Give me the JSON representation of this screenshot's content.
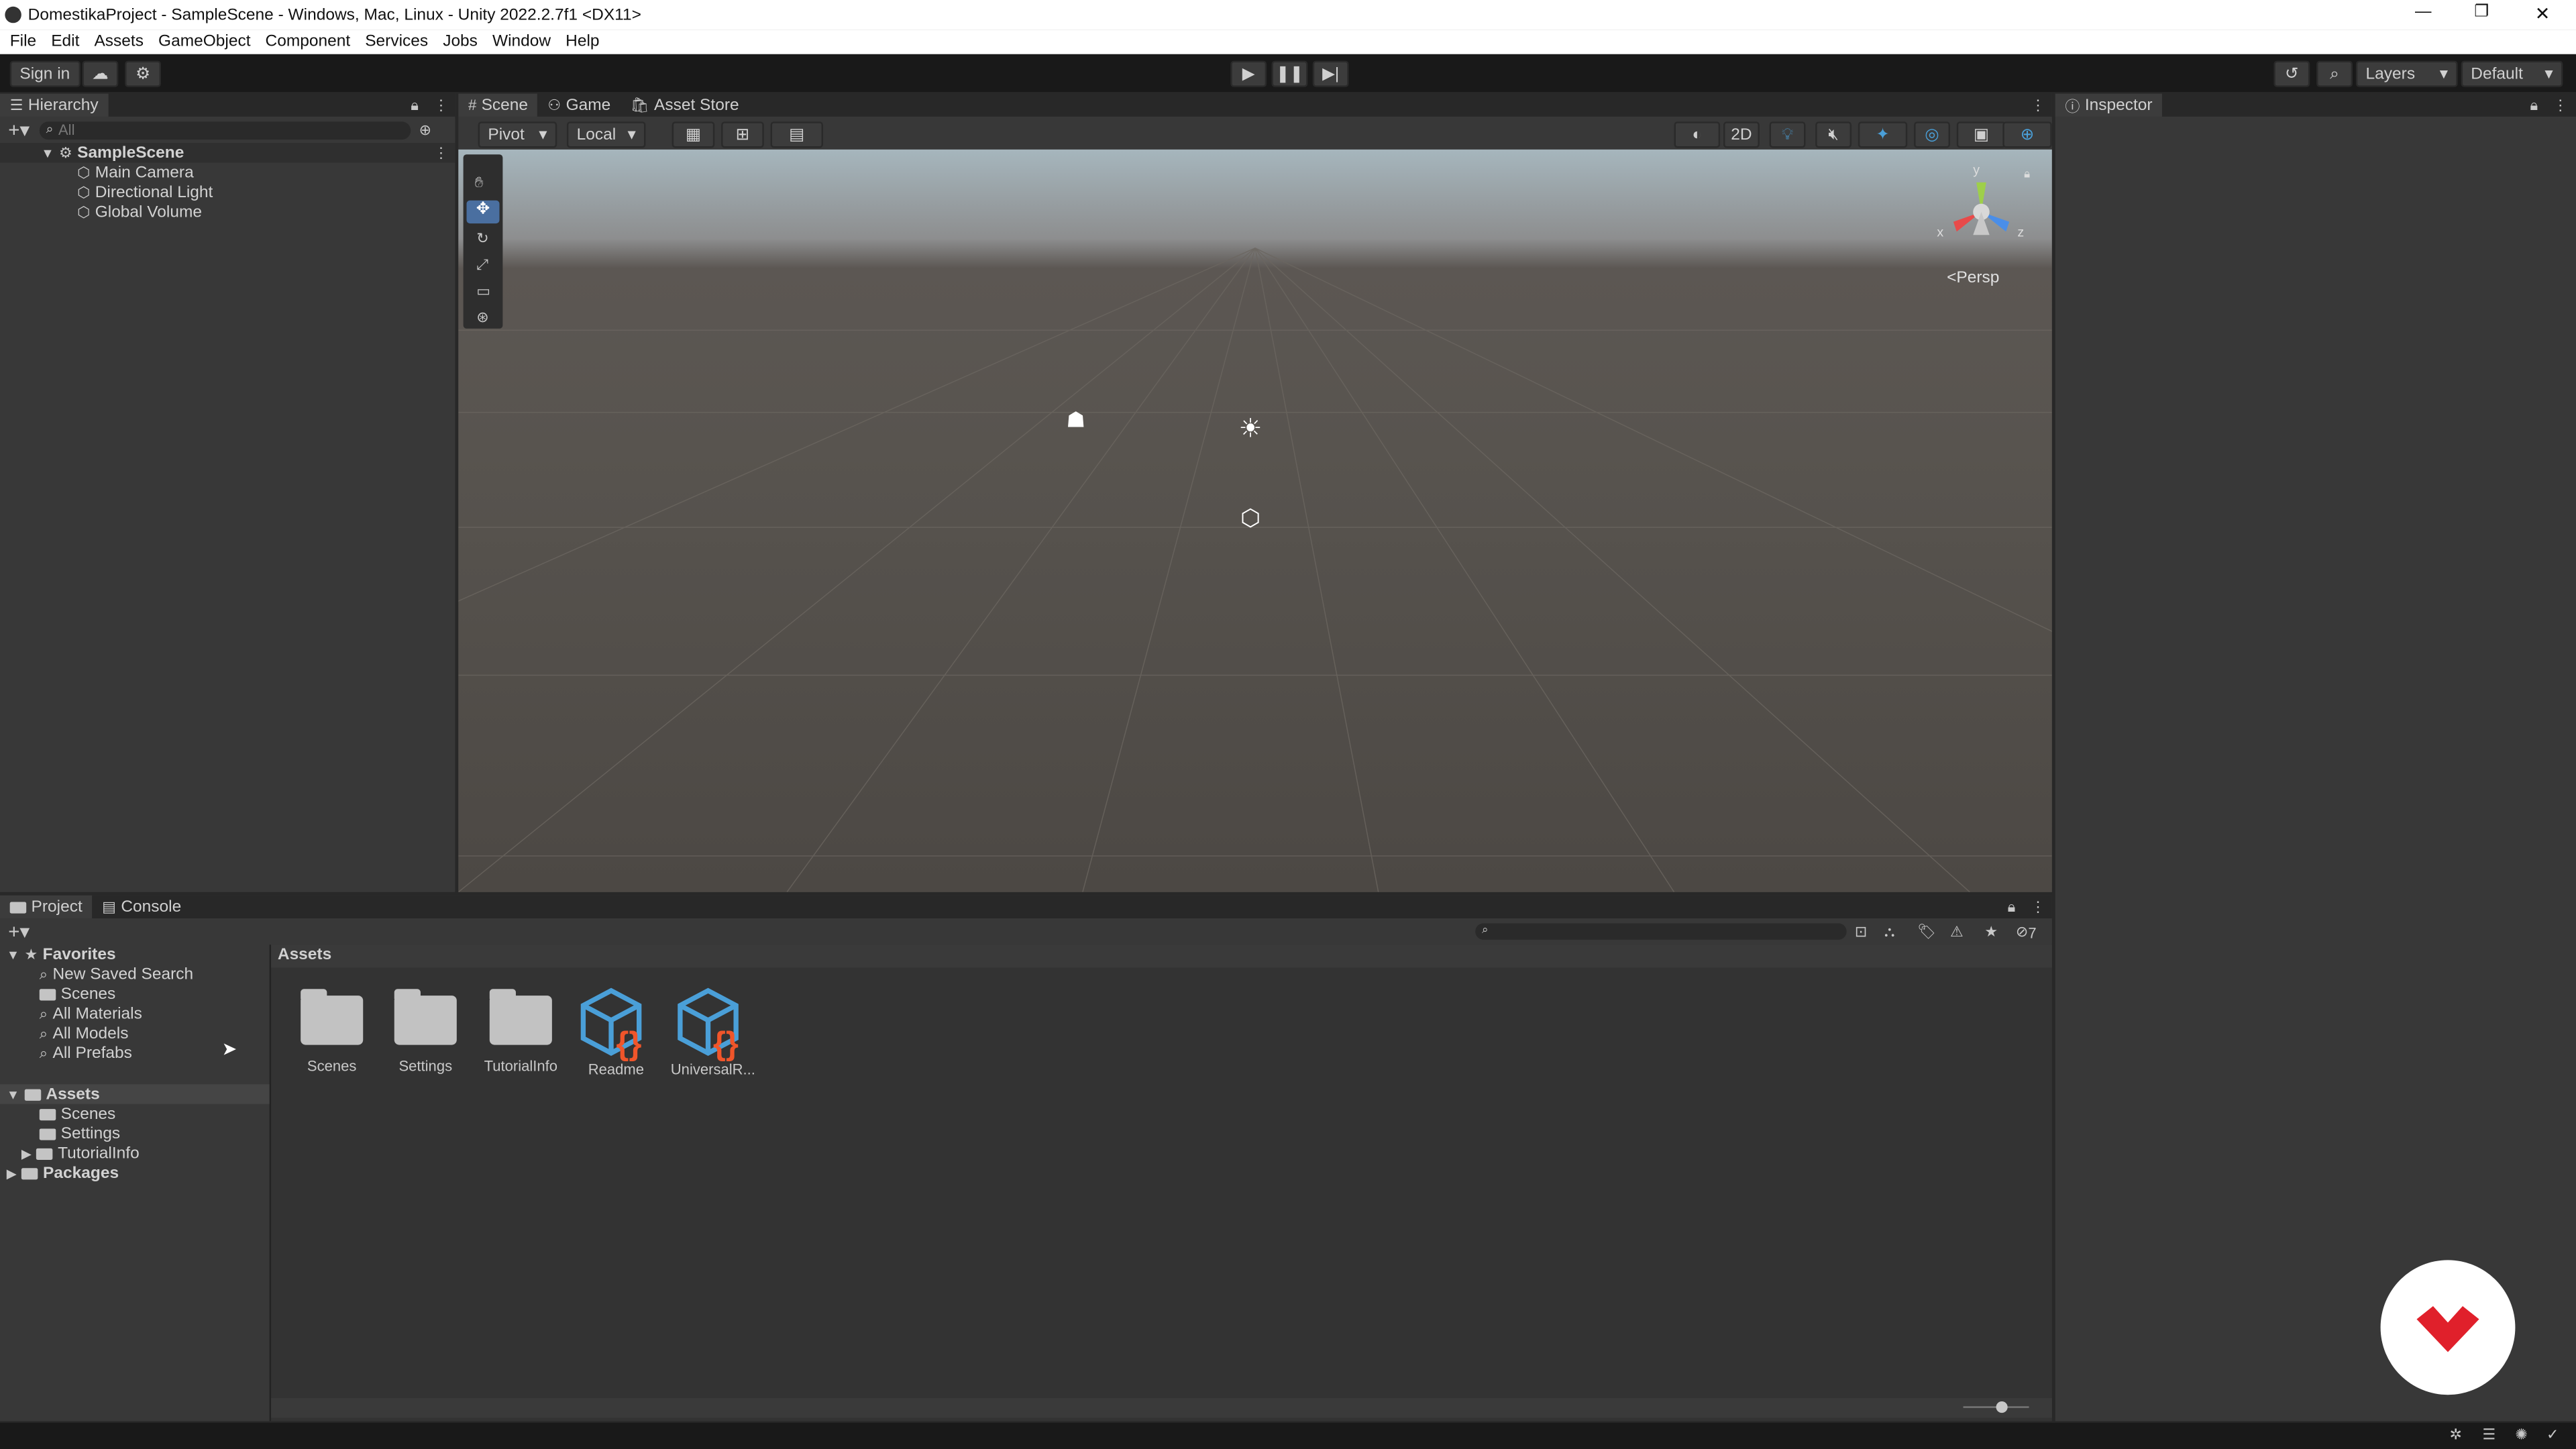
{
  "window": {
    "title": "DomestikaProject - SampleScene - Windows, Mac, Linux - Unity 2022.2.7f1 <DX11>",
    "controls": [
      "—",
      "❐",
      "✕"
    ]
  },
  "menu": [
    "File",
    "Edit",
    "Assets",
    "GameObject",
    "Component",
    "Services",
    "Jobs",
    "Window",
    "Help"
  ],
  "toolbar": {
    "sign_in": "Sign in",
    "layers": "Layers",
    "layout": "Default"
  },
  "hierarchy": {
    "tab": "Hierarchy",
    "search_placeholder": "All",
    "scene": "SampleScene",
    "items": [
      "Main Camera",
      "Directional Light",
      "Global Volume"
    ]
  },
  "scene_view": {
    "tabs": [
      "Scene",
      "Game",
      "Asset Store"
    ],
    "pivot": "Pivot",
    "local": "Local",
    "mode_2d": "2D",
    "persp": "<Persp",
    "gizmo_axes": {
      "y": "y",
      "x": "x",
      "z": "z"
    }
  },
  "inspector": {
    "tab": "Inspector"
  },
  "bottom": {
    "tabs": [
      "Project",
      "Console"
    ],
    "hidden_count": "7",
    "favorites_label": "Favorites",
    "favorites": [
      "New Saved Search",
      "Scenes",
      "All Materials",
      "All Models",
      "All Prefabs"
    ],
    "assets_label": "Assets",
    "assets_tree": [
      "Scenes",
      "Settings",
      "TutorialInfo"
    ],
    "packages_label": "Packages",
    "breadcrumb": "Assets",
    "grid": [
      {
        "name": "Scenes",
        "type": "folder"
      },
      {
        "name": "Settings",
        "type": "folder"
      },
      {
        "name": "TutorialInfo",
        "type": "folder"
      },
      {
        "name": "Readme",
        "type": "script"
      },
      {
        "name": "UniversalR...",
        "type": "script"
      }
    ]
  },
  "colors": {
    "accent_blue": "#4a9fd8",
    "script_orange": "#f0552a",
    "domestika_red": "#e0202b"
  }
}
